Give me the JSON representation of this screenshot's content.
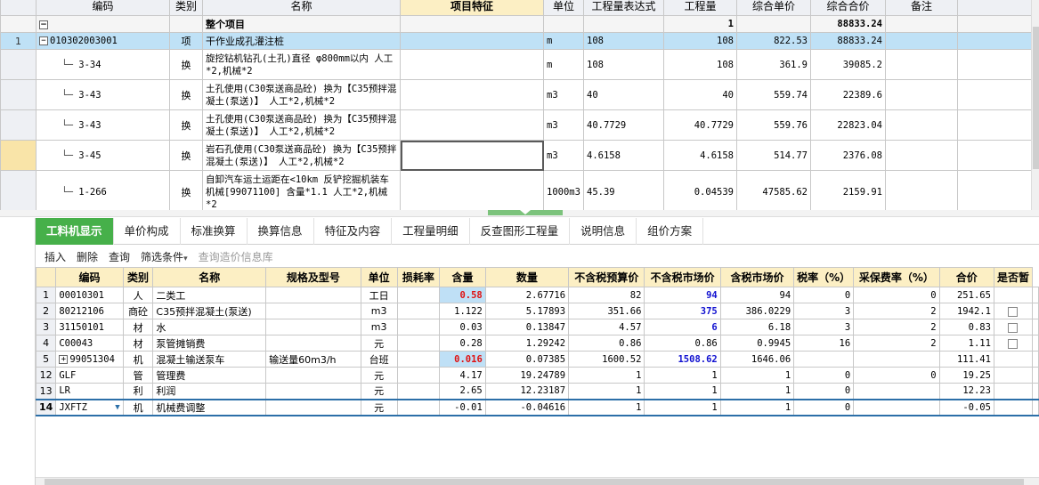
{
  "top": {
    "headers": [
      "编码",
      "类别",
      "名称",
      "项目特征",
      "单位",
      "工程量表达式",
      "工程量",
      "综合单价",
      "综合合价",
      "备注"
    ],
    "root": {
      "name": "整个项目",
      "quantity": "1",
      "total": "88833.24",
      "toggle": "−"
    },
    "rows": [
      {
        "rn": "1",
        "code": "010302003001",
        "type": "项",
        "name": "干作业成孔灌注桩",
        "unit": "m",
        "expr": "108",
        "qty": "108",
        "price": "822.53",
        "total": "88833.24",
        "toggle": "−"
      },
      {
        "rn": "",
        "code": "3-34",
        "type": "换",
        "name": "旋挖钻机钻孔(土孔)直径 φ800mm以内 人工*2,机械*2",
        "unit": "m",
        "expr": "108",
        "qty": "108",
        "price": "361.9",
        "total": "39085.2"
      },
      {
        "rn": "",
        "code": "3-43",
        "type": "换",
        "name": "土孔使用(C30泵送商品砼) 换为【C35预拌混凝土(泵送)】 人工*2,机械*2",
        "unit": "m3",
        "expr": "40",
        "qty": "40",
        "price": "559.74",
        "total": "22389.6"
      },
      {
        "rn": "",
        "code": "3-43",
        "type": "换",
        "name": "土孔使用(C30泵送商品砼) 换为【C35预拌混凝土(泵送)】 人工*2,机械*2",
        "unit": "m3",
        "expr": "40.7729",
        "qty": "40.7729",
        "price": "559.76",
        "total": "22823.04"
      },
      {
        "rn": "",
        "code": "3-45",
        "type": "换",
        "name": "岩石孔使用(C30泵送商品砼) 换为【C35预拌混凝土(泵送)】 人工*2,机械*2",
        "unit": "m3",
        "expr": "4.6158",
        "qty": "4.6158",
        "price": "514.77",
        "total": "2376.08"
      },
      {
        "rn": "",
        "code": "1-266",
        "type": "换",
        "name": "自卸汽车运土运距在<10km 反铲挖掘机装车 机械[99071100] 含量*1.1 人工*2,机械*2",
        "unit": "1000m3",
        "expr": "45.39",
        "qty": "0.04539",
        "price": "47585.62",
        "total": "2159.91"
      }
    ]
  },
  "tabs": [
    "工料机显示",
    "单价构成",
    "标准换算",
    "换算信息",
    "特征及内容",
    "工程量明细",
    "反查图形工程量",
    "说明信息",
    "组价方案"
  ],
  "toolbar": {
    "insert": "插入",
    "delete": "删除",
    "query": "查询",
    "filter": "筛选条件",
    "query_price": "查询造价信息库"
  },
  "bottom": {
    "headers": [
      "编码",
      "类别",
      "名称",
      "规格及型号",
      "单位",
      "损耗率",
      "含量",
      "数量",
      "不含税预算价",
      "不含税市场价",
      "含税市场价",
      "税率（%）",
      "采保费率（%）",
      "合价",
      "是否暂"
    ],
    "rows": [
      {
        "rn": "1",
        "code": "00010301",
        "type": "人",
        "name": "二类工",
        "spec": "",
        "unit": "工日",
        "loss": "",
        "content": "0.58",
        "qty": "2.67716",
        "budget": "82",
        "market": "94",
        "tax_market": "94",
        "rate": "0",
        "fee": "0",
        "total": "251.65",
        "chk": false
      },
      {
        "rn": "2",
        "code": "80212106",
        "type": "商砼",
        "name": "C35预拌混凝土(泵送)",
        "spec": "",
        "unit": "m3",
        "loss": "",
        "content": "1.122",
        "qty": "5.17893",
        "budget": "351.66",
        "market": "375",
        "tax_market": "386.0229",
        "rate": "3",
        "fee": "2",
        "total": "1942.1",
        "chk": true
      },
      {
        "rn": "3",
        "code": "31150101",
        "type": "材",
        "name": "水",
        "spec": "",
        "unit": "m3",
        "loss": "",
        "content": "0.03",
        "qty": "0.13847",
        "budget": "4.57",
        "market": "6",
        "tax_market": "6.18",
        "rate": "3",
        "fee": "2",
        "total": "0.83",
        "chk": true
      },
      {
        "rn": "4",
        "code": "C00043",
        "type": "材",
        "name": "泵管摊销费",
        "spec": "",
        "unit": "元",
        "loss": "",
        "content": "0.28",
        "qty": "1.29242",
        "budget": "0.86",
        "market": "0.86",
        "tax_market": "0.9945",
        "rate": "16",
        "fee": "2",
        "total": "1.11",
        "chk": true
      },
      {
        "rn": "5",
        "code": "99051304",
        "type": "机",
        "name": "混凝土输送泵车",
        "spec": "输送量60m3/h",
        "unit": "台班",
        "loss": "",
        "content": "0.016",
        "qty": "0.07385",
        "budget": "1600.52",
        "market": "1508.62",
        "tax_market": "1646.06",
        "rate": "",
        "fee": "",
        "total": "111.41",
        "chk": false
      },
      {
        "rn": "12",
        "code": "GLF",
        "type": "管",
        "name": "管理费",
        "spec": "",
        "unit": "元",
        "loss": "",
        "content": "4.17",
        "qty": "19.24789",
        "budget": "1",
        "market": "1",
        "tax_market": "1",
        "rate": "0",
        "fee": "0",
        "total": "19.25",
        "chk": false
      },
      {
        "rn": "13",
        "code": "LR",
        "type": "利",
        "name": "利润",
        "spec": "",
        "unit": "元",
        "loss": "",
        "content": "2.65",
        "qty": "12.23187",
        "budget": "1",
        "market": "1",
        "tax_market": "1",
        "rate": "0",
        "fee": "",
        "total": "12.23",
        "chk": false
      },
      {
        "rn": "14",
        "code": "JXFTZ",
        "type": "机",
        "name": "机械费调整",
        "spec": "",
        "unit": "元",
        "loss": "",
        "content": "-0.01",
        "qty": "-0.04616",
        "budget": "1",
        "market": "1",
        "tax_market": "1",
        "rate": "0",
        "fee": "",
        "total": "-0.05",
        "chk": false
      }
    ],
    "expand_toggle": "+"
  },
  "colors": {
    "tab_active": "#46b04a",
    "header_highlight": "#fcefc4",
    "selected_row": "#bfe1f6",
    "red_value": "#e01010",
    "blue_value": "#1010d0"
  }
}
